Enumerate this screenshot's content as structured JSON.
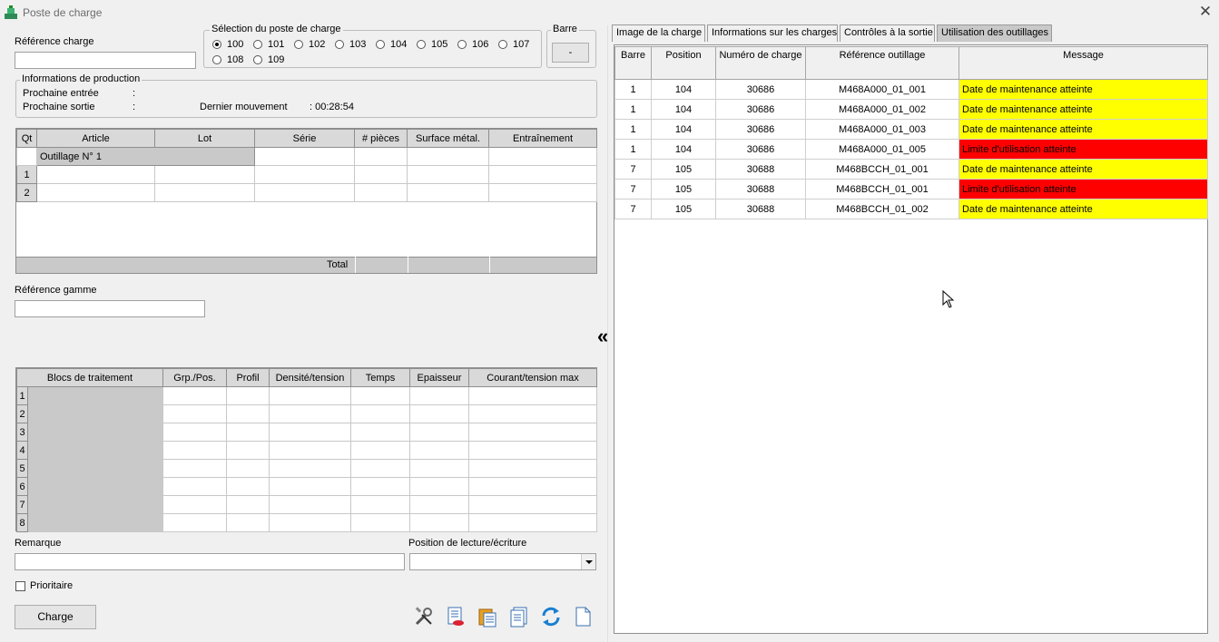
{
  "window": {
    "title": "Poste de charge",
    "close": "✕"
  },
  "ref_charge": {
    "label": "Référence charge",
    "value": ""
  },
  "station_select": {
    "label": "Sélection du poste de charge",
    "options": [
      "100",
      "101",
      "102",
      "103",
      "104",
      "105",
      "106",
      "107",
      "108",
      "109"
    ],
    "selected": "100"
  },
  "barre": {
    "label": "Barre",
    "button": "-"
  },
  "production_info": {
    "label": "Informations de production",
    "next_in_label": "Prochaine entrée",
    "next_in_value": ":",
    "next_out_label": "Prochaine sortie",
    "next_out_value": ":",
    "last_move_label": "Dernier mouvement",
    "last_move_value": ": 00:28:54"
  },
  "articles_table": {
    "headers": [
      "Qt",
      "Article",
      "Lot",
      "Série",
      "# pièces",
      "Surface métal.",
      "Entraînement"
    ],
    "tooling_row": "Outillage N° 1",
    "row_numbers": [
      "1",
      "2"
    ],
    "total_label": "Total"
  },
  "ref_gamme": {
    "label": "Référence gamme",
    "value": ""
  },
  "collapse_icon": "«",
  "treatment_table": {
    "headers": [
      "Blocs de traitement",
      "Grp./Pos.",
      "Profil",
      "Densité/tension",
      "Temps",
      "Epaisseur",
      "Courant/tension max"
    ],
    "row_numbers": [
      "1",
      "2",
      "3",
      "4",
      "5",
      "6",
      "7",
      "8"
    ]
  },
  "remarque": {
    "label": "Remarque",
    "value": ""
  },
  "rw_position": {
    "label": "Position de lecture/écriture",
    "value": ""
  },
  "priority": {
    "label": "Prioritaire",
    "checked": false
  },
  "charge_button": "Charge",
  "toolbar_icons": [
    "tools-icon",
    "delete-document-icon",
    "clipboard-icon",
    "documents-icon",
    "refresh-icon",
    "blank-document-icon"
  ],
  "tabs": [
    "Image de la charge",
    "Informations sur les charges",
    "Contrôles à la sortie",
    "Utilisation des outillages"
  ],
  "active_tab": 3,
  "usage_table": {
    "headers": [
      "Barre",
      "Position",
      "Numéro de charge",
      "Référence outillage",
      "Message"
    ],
    "rows": [
      {
        "barre": "1",
        "position": "104",
        "charge": "30686",
        "ref": "M468A000_01_001",
        "message": "Date de maintenance atteinte",
        "level": "warning"
      },
      {
        "barre": "1",
        "position": "104",
        "charge": "30686",
        "ref": "M468A000_01_002",
        "message": "Date de maintenance atteinte",
        "level": "warning"
      },
      {
        "barre": "1",
        "position": "104",
        "charge": "30686",
        "ref": "M468A000_01_003",
        "message": "Date de maintenance atteinte",
        "level": "warning"
      },
      {
        "barre": "1",
        "position": "104",
        "charge": "30686",
        "ref": "M468A000_01_005",
        "message": "Limite d'utilisation atteinte",
        "level": "error"
      },
      {
        "barre": "7",
        "position": "105",
        "charge": "30688",
        "ref": "M468BCCH_01_001",
        "message": "Date de maintenance atteinte",
        "level": "warning"
      },
      {
        "barre": "7",
        "position": "105",
        "charge": "30688",
        "ref": "M468BCCH_01_001",
        "message": "Limite d'utilisation atteinte",
        "level": "error"
      },
      {
        "barre": "7",
        "position": "105",
        "charge": "30688",
        "ref": "M468BCCH_01_002",
        "message": "Date de maintenance atteinte",
        "level": "warning"
      }
    ]
  },
  "colors": {
    "warning": "#ffff00",
    "error": "#ff0000",
    "header_grey": "#d9d9d9"
  }
}
